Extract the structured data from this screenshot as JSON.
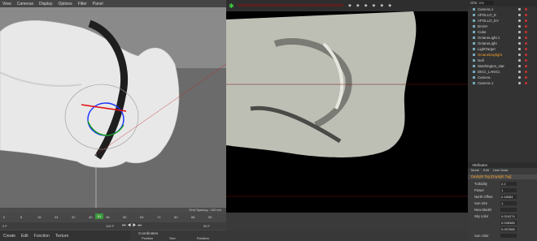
{
  "viewport": {
    "menu": [
      "View",
      "Cameras",
      "Display",
      "Options",
      "Filter",
      "Panel"
    ],
    "grid_spacing": "Grid Spacing : 100 cm"
  },
  "render_toolbar": {
    "label": "Chn",
    "zoom": "0%"
  },
  "object_manager": {
    "top_label": "Chn",
    "top_zoom": "0%",
    "items": [
      {
        "label": "Camera.1",
        "color": "#d0d0d0"
      },
      {
        "label": "APOLLO_E",
        "color": "#d0d0d0"
      },
      {
        "label": "APOLLO_EV",
        "color": "#d0d0d0"
      },
      {
        "label": "BASH",
        "color": "#d0d0d0"
      },
      {
        "label": "Cube",
        "color": "#d0d0d0"
      },
      {
        "label": "OctaneLight.1",
        "color": "#d0d0d0"
      },
      {
        "label": "OctaneLight",
        "color": "#d0d0d0"
      },
      {
        "label": "LightTarget",
        "color": "#d0d0d0"
      },
      {
        "label": "OctaneDaylight",
        "color": "#f0a030"
      },
      {
        "label": "Null",
        "color": "#d0d0d0"
      },
      {
        "label": "Washington_stat",
        "color": "#d0d0d0"
      },
      {
        "label": "DECI_LANG1",
        "color": "#d0d0d0"
      },
      {
        "label": "Camera",
        "color": "#d0d0d0"
      },
      {
        "label": "Camera.1",
        "color": "#d0d0d0"
      }
    ]
  },
  "attributes": {
    "header": "Attributes",
    "tabs": [
      "Mode",
      "Edit",
      "User Data"
    ],
    "tag_title": "Daylight Tag [Daylight Tag]",
    "fields": [
      {
        "key": "Turbidity",
        "value": "2.2"
      },
      {
        "key": "Power",
        "value": "1."
      },
      {
        "key": "North Offset",
        "value": "0.18084"
      },
      {
        "key": "Sun size",
        "value": "1."
      },
      {
        "key": "New Model",
        "value": ""
      },
      {
        "key": "Sky color",
        "value": "0.024274"
      },
      {
        "key": "",
        "value": "0.038385"
      },
      {
        "key": "",
        "value": "0.097665"
      },
      {
        "key": "Sun color",
        "value": ""
      }
    ]
  },
  "timeline": {
    "ticks": [
      "0",
      "8",
      "16",
      "24",
      "32",
      "40",
      "48",
      "56",
      "64",
      "72",
      "80",
      "88",
      "96"
    ],
    "current_frame": "51",
    "start": "0 F",
    "end_frame": "100 F",
    "end_frame2": "90 F"
  },
  "bottom": {
    "left_tabs": [
      "Create",
      "Edit",
      "Function",
      "Texture"
    ],
    "coord_label": "Coordinates",
    "coord_cols": [
      "Position",
      "Size",
      "Rotation"
    ]
  }
}
